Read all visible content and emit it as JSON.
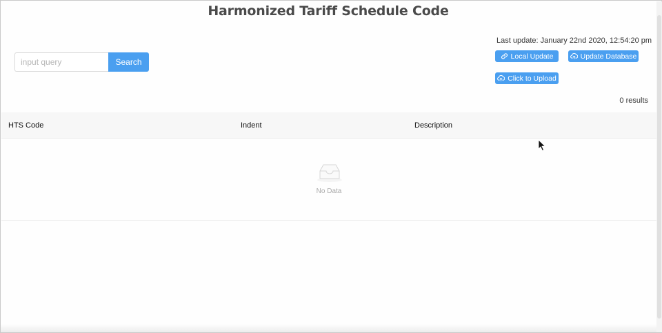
{
  "page": {
    "title": "Harmonized Tariff Schedule Code"
  },
  "search": {
    "placeholder": "input query",
    "value": "",
    "button_label": "Search"
  },
  "status": {
    "last_update": "Last update: January 22nd 2020, 12:54:20 pm",
    "results": "0 results"
  },
  "actions": {
    "local_update": {
      "label": "Local Update",
      "icon": "link-icon"
    },
    "update_database": {
      "label": "Update Database",
      "icon": "cloud-upload-icon"
    },
    "click_to_upload": {
      "label": "Click to Upload",
      "icon": "cloud-upload-icon"
    }
  },
  "table": {
    "columns": [
      "HTS Code",
      "Indent",
      "Description"
    ],
    "rows": [],
    "empty_text": "No Data"
  },
  "colors": {
    "accent": "#4a9ff0",
    "title": "#4a4a4a",
    "header_bg": "#f7f7f7",
    "empty_text": "#a9a9a9"
  }
}
